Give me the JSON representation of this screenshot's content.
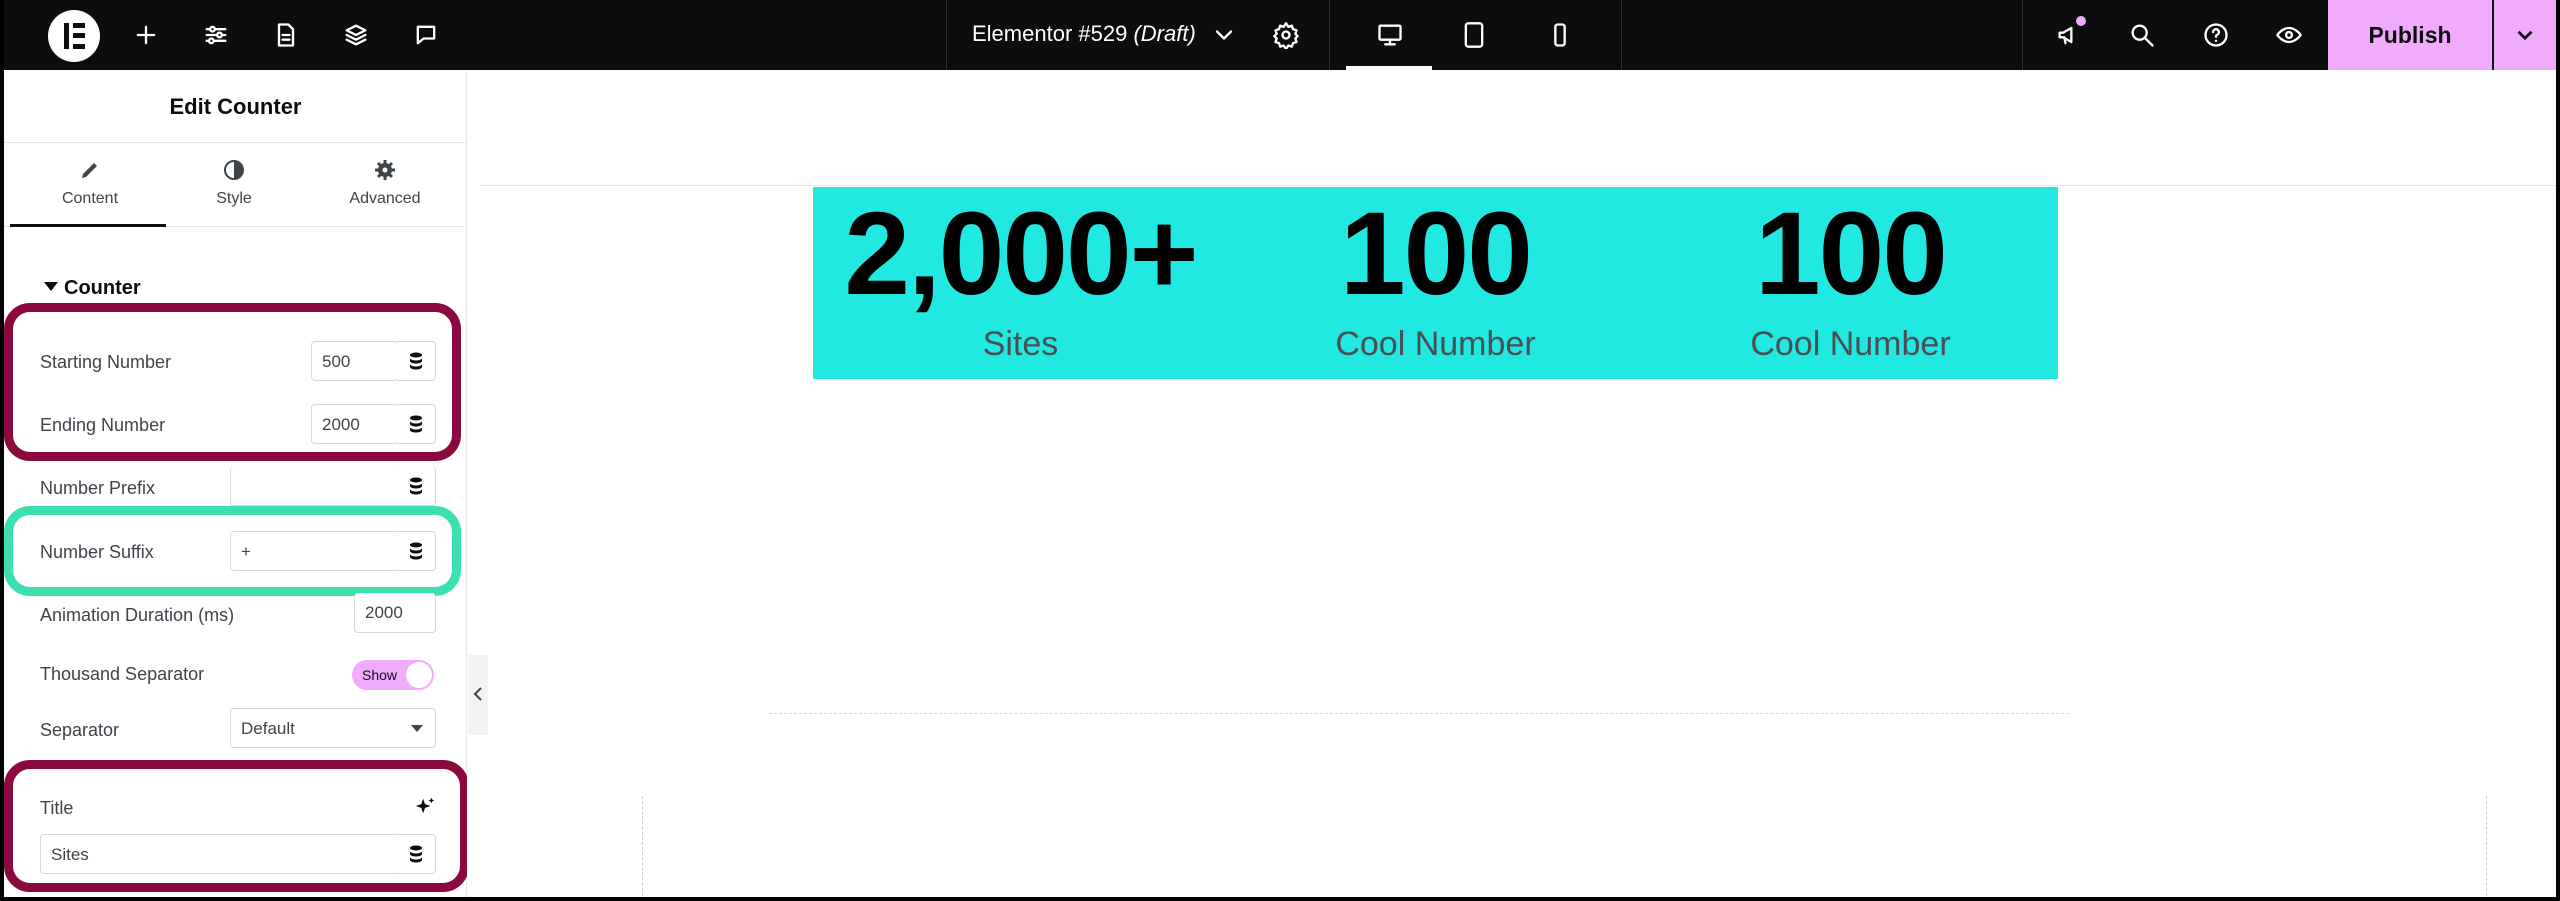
{
  "topbar": {
    "document_name": "Elementor #529",
    "document_status": "(Draft)",
    "publish_label": "Publish",
    "icons": [
      "elementor-logo-icon",
      "add-icon",
      "sliders-icon",
      "document-icon",
      "layers-icon",
      "comment-icon",
      "settings-icon",
      "desktop-icon",
      "tablet-icon",
      "mobile-icon",
      "megaphone-icon",
      "search-icon",
      "help-icon",
      "preview-eye-icon",
      "chevron-down-icon"
    ]
  },
  "panel": {
    "title": "Edit Counter",
    "tabs": [
      {
        "label": "Content",
        "icon": "pencil-icon",
        "active": true
      },
      {
        "label": "Style",
        "icon": "half-circle-icon"
      },
      {
        "label": "Advanced",
        "icon": "gear-icon"
      }
    ],
    "section": "Counter",
    "fields": {
      "starting_number": {
        "label": "Starting Number",
        "value": "500"
      },
      "ending_number": {
        "label": "Ending Number",
        "value": "2000"
      },
      "number_prefix": {
        "label": "Number Prefix",
        "value": ""
      },
      "number_suffix": {
        "label": "Number Suffix",
        "value": "+"
      },
      "animation_duration": {
        "label": "Animation Duration (ms)",
        "value": "2000"
      },
      "thousand_separator": {
        "label": "Thousand Separator",
        "toggle_label": "Show",
        "on": true
      },
      "separator": {
        "label": "Separator",
        "value": "Default"
      },
      "title": {
        "label": "Title",
        "value": "Sites"
      }
    },
    "highlight_colors": {
      "red": "#8a0a3f",
      "green": "#3ce0b0"
    }
  },
  "canvas": {
    "accent": "#21e8e0",
    "counters": [
      {
        "number": "2,000+",
        "title": "Sites"
      },
      {
        "number": "100",
        "title": "Cool Number"
      },
      {
        "number": "100",
        "title": "Cool Number"
      }
    ]
  }
}
